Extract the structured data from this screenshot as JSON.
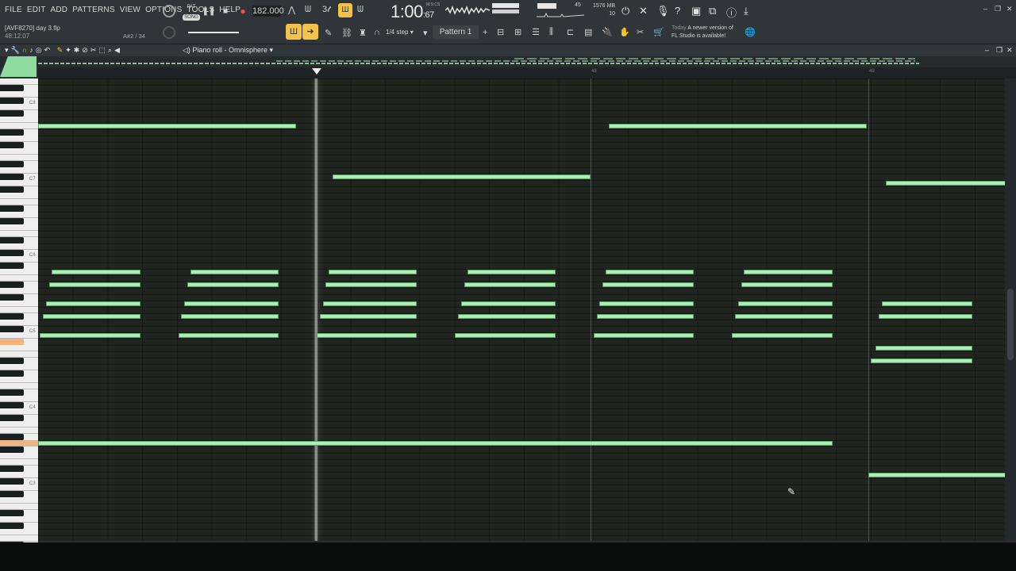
{
  "menu": [
    "FILE",
    "EDIT",
    "ADD",
    "PATTERNS",
    "VIEW",
    "OPTIONS",
    "TOOLS",
    "HELP"
  ],
  "project": {
    "file": "[AVF8270] day 3.flp",
    "time": "48:12:07"
  },
  "hint_text": "A#2 / 34",
  "transport": {
    "song_label": "SONG",
    "pat_label": "PAT",
    "tempo": "182.000"
  },
  "clock": {
    "main": "1:00",
    "sub": ":67",
    "mode": "M:S:CS"
  },
  "cpu": {
    "value": "45"
  },
  "memory": {
    "mb": "1576 MB",
    "poly": "10"
  },
  "snap": "1/4 step",
  "pattern": "Pattern 1",
  "news": {
    "label": "Today",
    "line1": "A newer version of",
    "line2": "FL Studio is available!"
  },
  "piano_roll": {
    "title": "Piano roll - Omnisphere"
  },
  "ruler": [
    "48",
    "49"
  ],
  "key_labels": [
    "C8",
    "C7",
    "C6",
    "C5",
    "C4",
    "C3"
  ],
  "colors": {
    "note": "#a8f0b4",
    "accent": "#f2c24a",
    "highlight_key": "#f4b27a"
  },
  "notes": [
    {
      "start_step": 0,
      "length_steps": 30,
      "pitch": "D#7"
    },
    {
      "start_step": 34,
      "length_steps": 30,
      "pitch": "F6"
    },
    {
      "start_step": 66,
      "length_steps": 30,
      "pitch": "D#7"
    },
    {
      "start_step": 98,
      "length_steps": 14,
      "pitch": "E6"
    },
    {
      "start_step": 0,
      "length_steps": 92,
      "pitch": "A#3"
    },
    {
      "start_step": 96,
      "length_steps": 16,
      "pitch": "F3"
    }
  ],
  "note_repeats": 6
}
